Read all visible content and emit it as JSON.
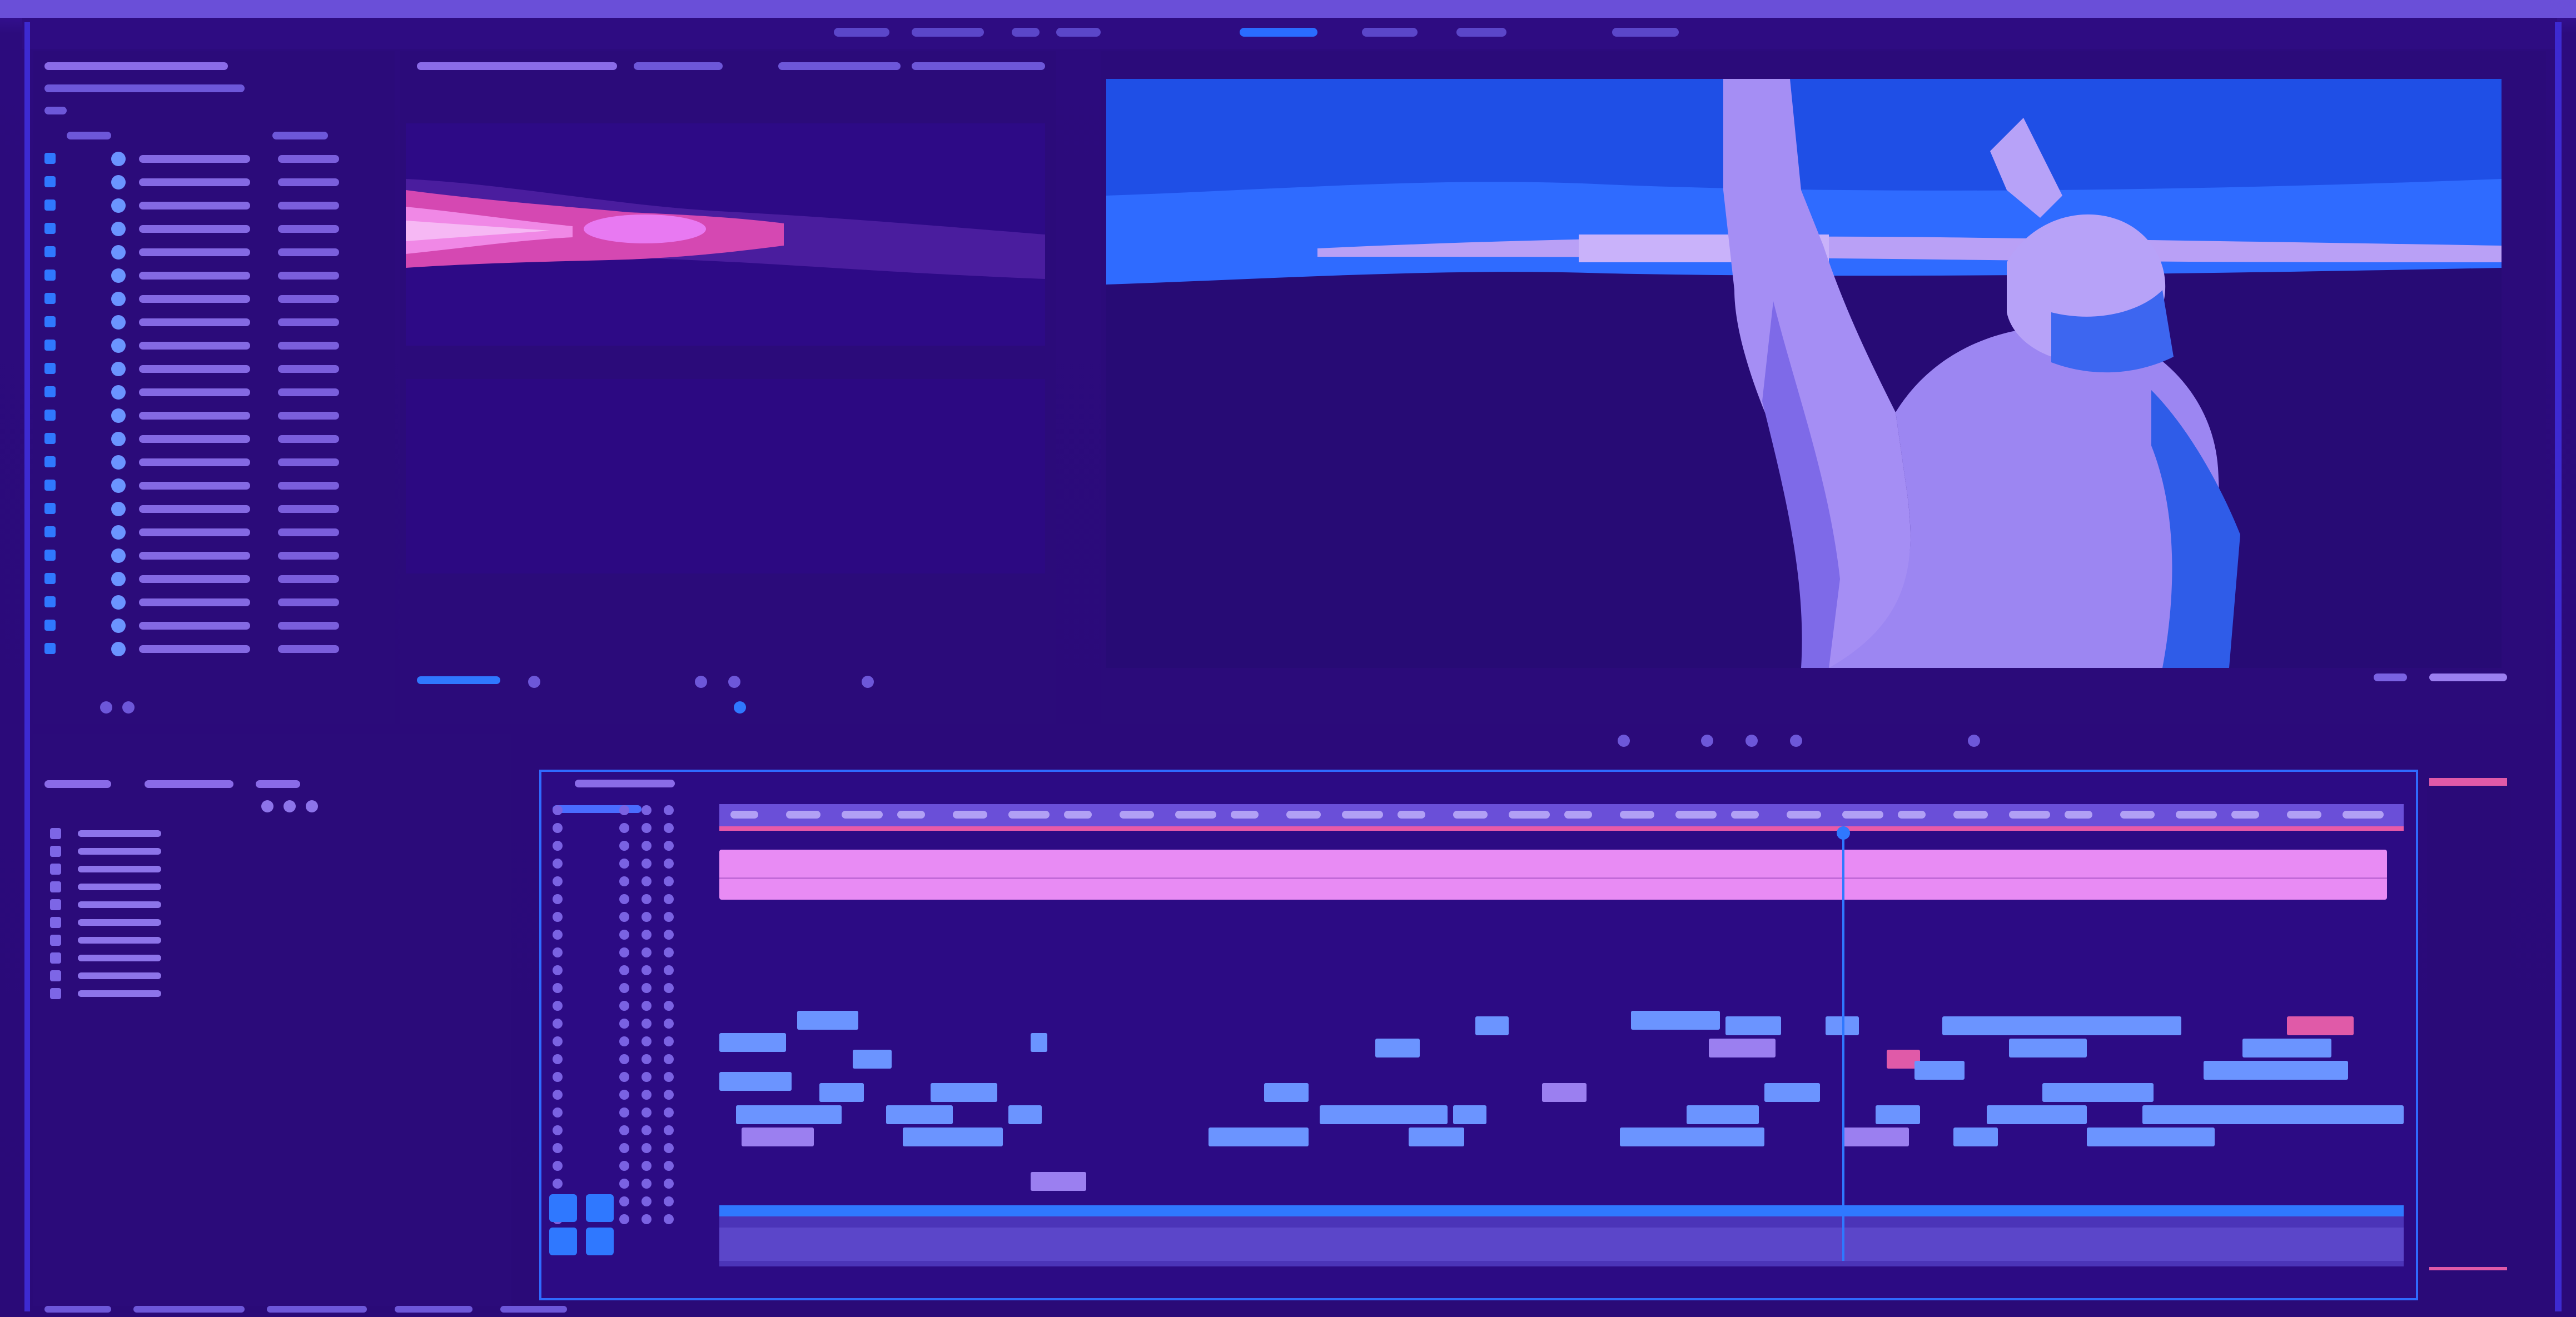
{
  "app": {
    "accent_color": "#2f78ff",
    "highlight_color": "#e05aa8",
    "clip_color": "#6b94ff",
    "background_color": "#2a0a78"
  },
  "panels": {
    "project": {
      "icon": "folder-icon",
      "item_count_visible": 22
    },
    "source_monitor": {
      "icon": "monitor-icon"
    },
    "program_monitor": {
      "icon": "monitor-icon"
    },
    "effects": {
      "icon": "fx-icon"
    },
    "timeline": {
      "icon": "timeline-icon"
    }
  },
  "program_controls": [
    "step-back-icon",
    "play-icon",
    "step-forward-icon",
    "add-marker-icon",
    "settings-icon"
  ],
  "source_controls": [
    "mark-in-icon",
    "mark-out-icon",
    "play-icon",
    "insert-icon",
    "overwrite-icon"
  ],
  "timeline_tools": [
    "selection-tool-icon",
    "razor-tool-icon",
    "hand-tool-icon",
    "text-tool-icon"
  ]
}
